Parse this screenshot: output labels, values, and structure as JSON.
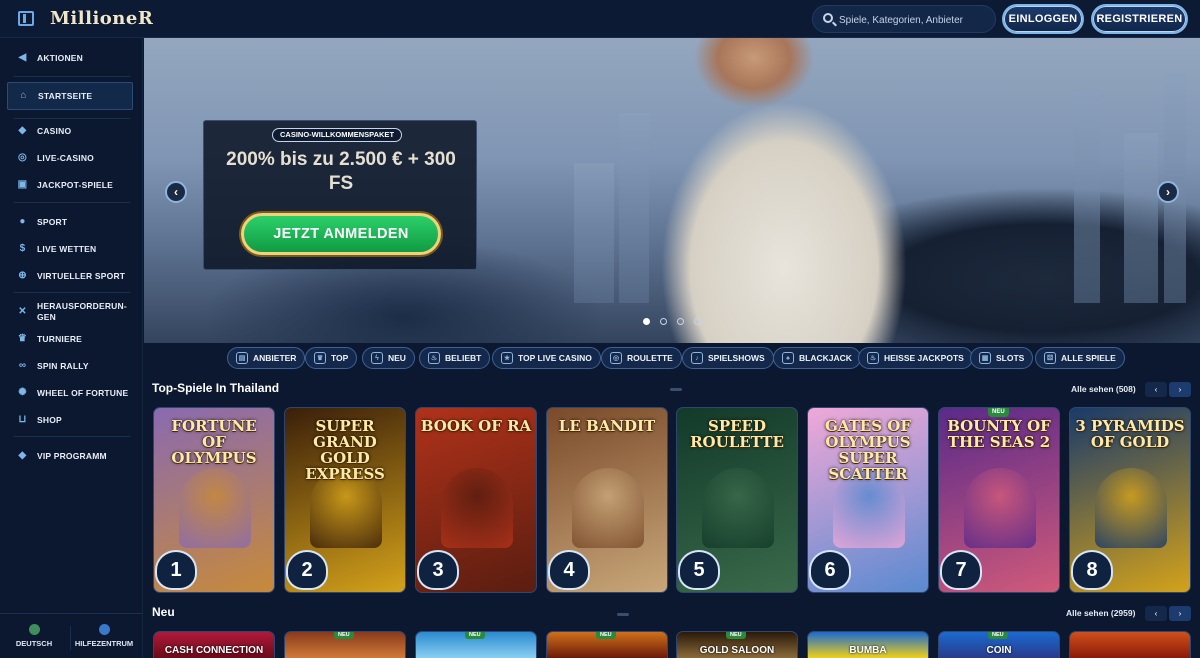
{
  "header": {
    "logo_text": "MillioneR",
    "search_placeholder": "Spiele, Kategorien, Anbieter",
    "login_label": "EINLOGGEN",
    "register_label": "REGISTRIEREN"
  },
  "sidebar": {
    "items": [
      {
        "label": "AKTIONEN",
        "icon": "megaphone-icon"
      },
      {
        "label": "STARTSEITE",
        "icon": "home-icon"
      },
      {
        "label": "CASINO",
        "icon": "diamond-icon"
      },
      {
        "label": "LIVE-CASINO",
        "icon": "chip-icon"
      },
      {
        "label": "JACKPOT-SPIELE",
        "icon": "jackpot-icon"
      },
      {
        "label": "SPORT",
        "icon": "soccer-ball-icon"
      },
      {
        "label": "LIVE WETTEN",
        "icon": "dollar-icon"
      },
      {
        "label": "VIRTUELLER SPORT",
        "icon": "globe-icon"
      },
      {
        "label": "HERAUSFORDERUN-GEN",
        "icon": "crossed-swords-icon"
      },
      {
        "label": "TURNIERE",
        "icon": "trophy-icon"
      },
      {
        "label": "SPIN RALLY",
        "icon": "rally-icon"
      },
      {
        "label": "WHEEL OF FORTUNE",
        "icon": "wheel-icon"
      },
      {
        "label": "SHOP",
        "icon": "cart-icon"
      },
      {
        "label": "VIP PROGRAMM",
        "icon": "gem-icon"
      }
    ],
    "language_label": "DEUTSCH",
    "help_label": "HILFEZENTRUM"
  },
  "hero": {
    "promo_tag": "CASINO-WILLKOMMENSPAKET",
    "promo_title": "200% bis zu 2.500 € + 300 FS",
    "cta_label": "JETZT ANMELDEN",
    "slide_count": 4,
    "active_slide": 1
  },
  "categories": [
    {
      "label": "ANBIETER",
      "icon": "provider-icon"
    },
    {
      "label": "TOP",
      "icon": "crown-icon"
    },
    {
      "label": "NEU",
      "icon": "bolt-icon"
    },
    {
      "label": "BELIEBT",
      "icon": "flame-icon"
    },
    {
      "label": "TOP LIVE CASINO",
      "icon": "star-icon"
    },
    {
      "label": "ROULETTE",
      "icon": "roulette-icon"
    },
    {
      "label": "SPIELSHOWS",
      "icon": "microphone-icon"
    },
    {
      "label": "BLACKJACK",
      "icon": "cards-icon"
    },
    {
      "label": "HEISSE JACKPOTS",
      "icon": "hot-icon"
    },
    {
      "label": "SLOTS",
      "icon": "slot-icon"
    },
    {
      "label": "ALLE SPIELE",
      "icon": "all-games-icon"
    }
  ],
  "top_games": {
    "title": "Top-Spiele In Thailand",
    "see_all": "Alle sehen (508)",
    "games": [
      {
        "name": "FORTUNE OF OLYMPUS",
        "rank": "1",
        "colors": [
          "#8a6ab0",
          "#c78a3a"
        ]
      },
      {
        "name": "SUPER GRAND GOLD EXPRESS",
        "rank": "2",
        "colors": [
          "#3a1f0a",
          "#d4a21a"
        ]
      },
      {
        "name": "BOOK OF RA",
        "rank": "3",
        "colors": [
          "#b0321a",
          "#5a1d10"
        ]
      },
      {
        "name": "LE BANDIT",
        "rank": "4",
        "colors": [
          "#7a4a2a",
          "#c9a77a"
        ]
      },
      {
        "name": "SPEED ROULETTE",
        "rank": "5",
        "colors": [
          "#123a2a",
          "#3a6a4a"
        ]
      },
      {
        "name": "GATES OF OLYMPUS SUPER SCATTER",
        "rank": "6",
        "colors": [
          "#f0a8d8",
          "#5a8ad0"
        ]
      },
      {
        "name": "BOUNTY OF THE SEAS 2",
        "rank": "7",
        "colors": [
          "#5a2a8a",
          "#d05a7a"
        ],
        "badge": "NEU"
      },
      {
        "name": "3 PYRAMIDS OF GOLD",
        "rank": "8",
        "colors": [
          "#1a3a6a",
          "#d4a21a"
        ]
      }
    ]
  },
  "new_games": {
    "title": "Neu",
    "see_all": "Alle sehen (2959)",
    "games": [
      {
        "name": "CASH CONNECTION",
        "colors": [
          "#b01a3a",
          "#6a0a1a"
        ]
      },
      {
        "name": "",
        "colors": [
          "#8a3a1a",
          "#d07a3a"
        ],
        "badge": "NEU"
      },
      {
        "name": "",
        "colors": [
          "#2a8ad0",
          "#8ad0f0"
        ],
        "badge": "NEU"
      },
      {
        "name": "",
        "colors": [
          "#d0701a",
          "#6a1a0a"
        ],
        "badge": "NEU"
      },
      {
        "name": "GOLD SALOON",
        "colors": [
          "#2a1a0a",
          "#8a6a3a"
        ],
        "badge": "NEU"
      },
      {
        "name": "BUMBA",
        "colors": [
          "#1a6ad0",
          "#f0d01a"
        ]
      },
      {
        "name": "COIN",
        "colors": [
          "#1a6ad0",
          "#2a3a8a"
        ],
        "badge": "NEU"
      },
      {
        "name": "",
        "colors": [
          "#d0501a",
          "#8a1a0a"
        ]
      }
    ]
  },
  "colors": {
    "background": "#0b1830",
    "accent": "#7fb6ea",
    "cta_green": "#1cb456",
    "cta_border": "#f0d27a"
  }
}
